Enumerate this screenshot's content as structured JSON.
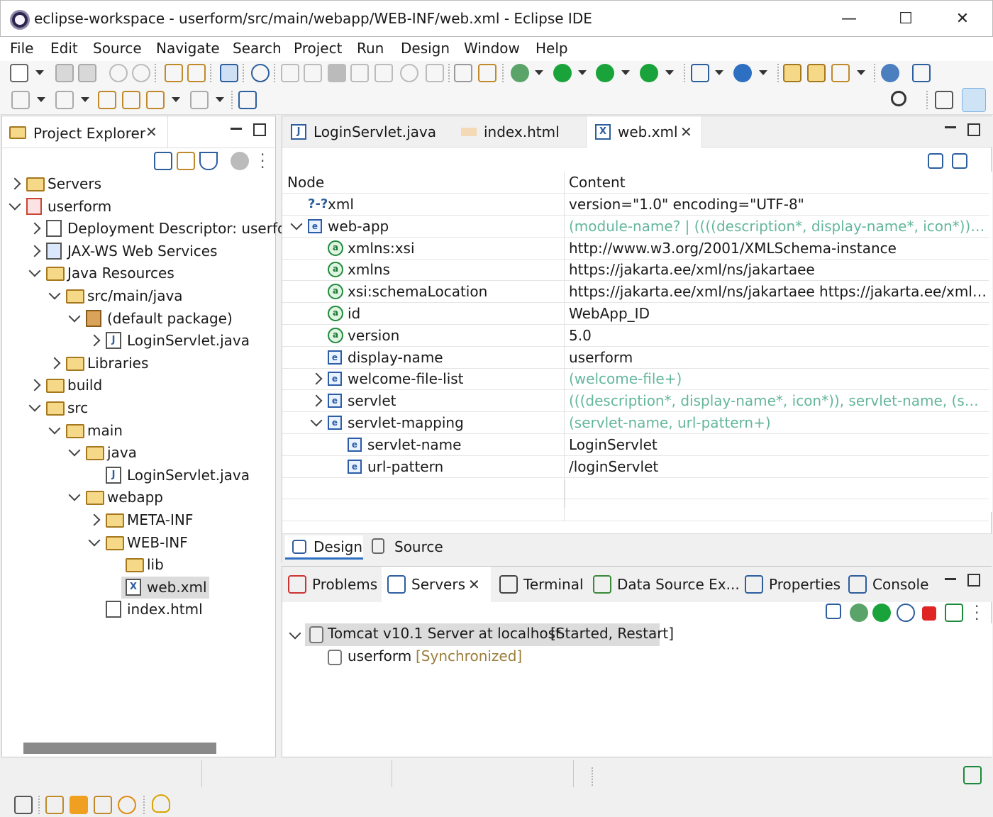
{
  "window": {
    "title": "eclipse-workspace - userform/src/main/webapp/WEB-INF/web.xml - Eclipse IDE",
    "minimize": "—",
    "maximize": "☐",
    "close": "✕"
  },
  "menu": [
    "File",
    "Edit",
    "Source",
    "Navigate",
    "Search",
    "Project",
    "Run",
    "Design",
    "Window",
    "Help"
  ],
  "project_explorer": {
    "tab_label": "Project Explorer",
    "tree": [
      {
        "label": "Servers",
        "depth": 0,
        "state": "collapsed",
        "icon": "folder-icon"
      },
      {
        "label": "userform",
        "depth": 0,
        "state": "expanded",
        "icon": "web-project-icon"
      },
      {
        "label": "Deployment Descriptor: userfor",
        "depth": 1,
        "state": "collapsed",
        "icon": "deployment-descriptor-icon"
      },
      {
        "label": "JAX-WS Web Services",
        "depth": 1,
        "state": "collapsed",
        "icon": "webservices-icon"
      },
      {
        "label": "Java Resources",
        "depth": 1,
        "state": "expanded",
        "icon": "java-resources-icon"
      },
      {
        "label": "src/main/java",
        "depth": 2,
        "state": "expanded",
        "icon": "source-folder-icon"
      },
      {
        "label": "(default package)",
        "depth": 3,
        "state": "expanded",
        "icon": "package-icon"
      },
      {
        "label": "LoginServlet.java",
        "depth": 4,
        "state": "collapsed",
        "icon": "java-file-icon"
      },
      {
        "label": "Libraries",
        "depth": 2,
        "state": "collapsed",
        "icon": "libraries-icon"
      },
      {
        "label": "build",
        "depth": 1,
        "state": "collapsed",
        "icon": "folder-icon"
      },
      {
        "label": "src",
        "depth": 1,
        "state": "expanded",
        "icon": "folder-icon"
      },
      {
        "label": "main",
        "depth": 2,
        "state": "expanded",
        "icon": "folder-icon"
      },
      {
        "label": "java",
        "depth": 3,
        "state": "expanded",
        "icon": "folder-icon"
      },
      {
        "label": "LoginServlet.java",
        "depth": 4,
        "state": "none",
        "icon": "java-file-icon"
      },
      {
        "label": "webapp",
        "depth": 3,
        "state": "expanded",
        "icon": "folder-icon"
      },
      {
        "label": "META-INF",
        "depth": 4,
        "state": "collapsed",
        "icon": "folder-icon"
      },
      {
        "label": "WEB-INF",
        "depth": 4,
        "state": "expanded",
        "icon": "folder-icon"
      },
      {
        "label": "lib",
        "depth": 5,
        "state": "none",
        "icon": "folder-icon"
      },
      {
        "label": "web.xml",
        "depth": 5,
        "state": "none",
        "icon": "xml-file-icon",
        "selected": true
      },
      {
        "label": "index.html",
        "depth": 4,
        "state": "none",
        "icon": "html-file-icon"
      }
    ]
  },
  "editor": {
    "tabs": [
      {
        "label": "LoginServlet.java",
        "icon": "java-file-icon"
      },
      {
        "label": "index.html",
        "icon": "html-file-icon"
      },
      {
        "label": "web.xml",
        "icon": "xml-file-icon",
        "active": true
      }
    ],
    "columns": {
      "node": "Node",
      "content": "Content"
    },
    "rows": [
      {
        "node": "xml",
        "prefix": "?-?",
        "content": "version=\"1.0\" encoding=\"UTF-8\"",
        "kind": "pi",
        "depth": 0,
        "state": "none",
        "hint": false
      },
      {
        "node": "web-app",
        "content": "(module-name? | ((((description*, display-name*, icon*)) | dist...",
        "kind": "element",
        "depth": 0,
        "state": "expanded",
        "hint": true
      },
      {
        "node": "xmlns:xsi",
        "content": "http://www.w3.org/2001/XMLSchema-instance",
        "kind": "attr",
        "depth": 1,
        "state": "none",
        "hint": false
      },
      {
        "node": "xmlns",
        "content": "https://jakarta.ee/xml/ns/jakartaee",
        "kind": "attr",
        "depth": 1,
        "state": "none",
        "hint": false
      },
      {
        "node": "xsi:schemaLocation",
        "content": "https://jakarta.ee/xml/ns/jakartaee https://jakarta.ee/xml/ns/ja...",
        "kind": "attr",
        "depth": 1,
        "state": "none",
        "hint": false
      },
      {
        "node": "id",
        "content": "WebApp_ID",
        "kind": "attr",
        "depth": 1,
        "state": "none",
        "hint": false
      },
      {
        "node": "version",
        "content": "5.0",
        "kind": "attr",
        "depth": 1,
        "state": "none",
        "hint": false
      },
      {
        "node": "display-name",
        "content": "userform",
        "kind": "element",
        "depth": 1,
        "state": "none",
        "hint": false
      },
      {
        "node": "welcome-file-list",
        "content": "(welcome-file+)",
        "kind": "element",
        "depth": 1,
        "state": "collapsed",
        "hint": true
      },
      {
        "node": "servlet",
        "content": "(((description*, display-name*, icon*)), servlet-name, (servlet-...",
        "kind": "element",
        "depth": 1,
        "state": "collapsed",
        "hint": true
      },
      {
        "node": "servlet-mapping",
        "content": "(servlet-name, url-pattern+)",
        "kind": "element",
        "depth": 1,
        "state": "expanded",
        "hint": true
      },
      {
        "node": "servlet-name",
        "content": "LoginServlet",
        "kind": "element",
        "depth": 2,
        "state": "none",
        "hint": false
      },
      {
        "node": "url-pattern",
        "content": "/loginServlet",
        "kind": "element",
        "depth": 2,
        "state": "none",
        "hint": false
      }
    ],
    "bottom_tabs": [
      {
        "label": "Design",
        "active": true
      },
      {
        "label": "Source"
      }
    ]
  },
  "bottom_panel": {
    "tabs": [
      {
        "label": "Problems",
        "icon": "problems-icon"
      },
      {
        "label": "Servers",
        "icon": "servers-icon",
        "active": true
      },
      {
        "label": "Terminal",
        "icon": "terminal-icon"
      },
      {
        "label": "Data Source Ex...",
        "icon": "data-source-icon"
      },
      {
        "label": "Properties",
        "icon": "properties-icon"
      },
      {
        "label": "Console",
        "icon": "console-icon"
      }
    ],
    "server": {
      "name": "Tomcat v10.1 Server at localhost",
      "status": "[Started, Restart]"
    },
    "module": {
      "name": "userform",
      "status": "[Synchronized]"
    }
  },
  "colors": {
    "folder": "#f6d889",
    "accent": "#2d5e9e",
    "hint": "#4fae8c",
    "selected": "#dcdcdc",
    "run_green": "#1aa33a",
    "stop_red": "#e02424"
  }
}
